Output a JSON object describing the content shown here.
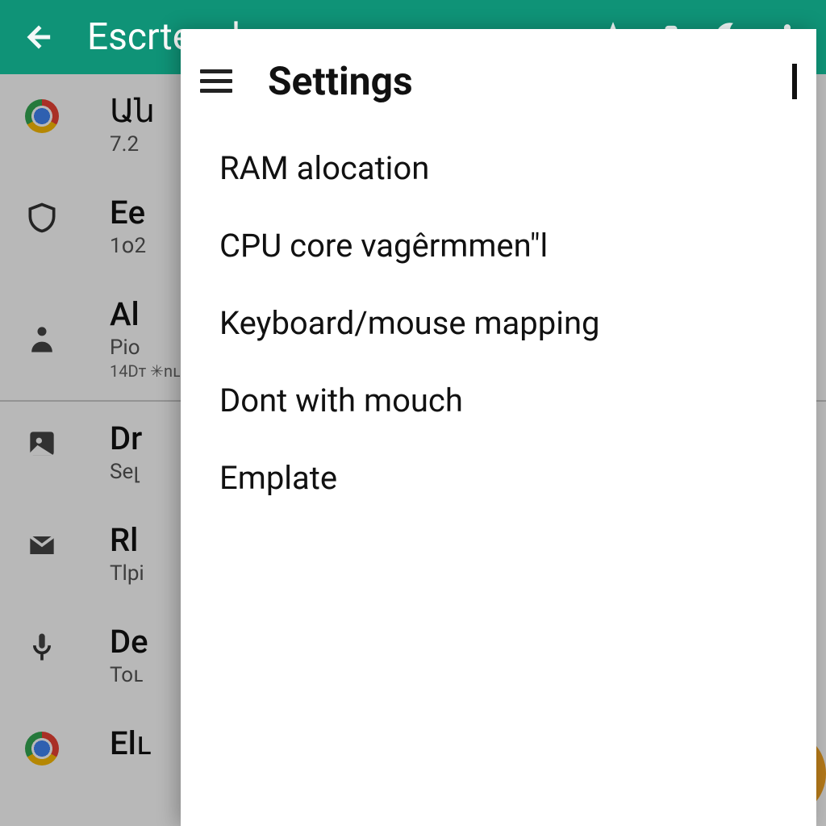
{
  "colors": {
    "accent": "#0f9377",
    "fab": "#f5a623"
  },
  "appbar": {
    "title": "Escrteach"
  },
  "background_list": {
    "rows": [
      {
        "title": "Ան",
        "sub": "7.2"
      },
      {
        "title": "Eе",
        "sub": "1օ2"
      },
      {
        "title": "Al",
        "sub": "Piо",
        "sub2": "14Dт  ✳nւ"
      },
      {
        "title": "Dr",
        "sub": "Seլ"
      },
      {
        "title": "Rl",
        "sub": "Tlpi"
      },
      {
        "title": "Dе",
        "sub": "Toւ"
      },
      {
        "title": "Elւ",
        "sub": ""
      }
    ]
  },
  "panel": {
    "title": "Settings",
    "items": [
      "RAM alocation",
      "CPU core vagêrmmen\"l",
      "Keyboard/mouse mapping",
      "Dont with mouch",
      "Emplate"
    ]
  }
}
